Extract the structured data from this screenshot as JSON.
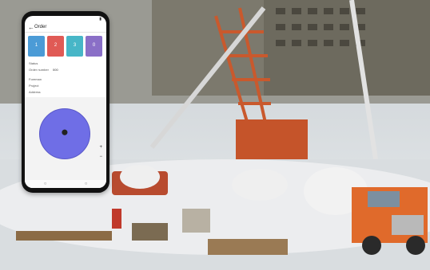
{
  "phone": {
    "status_time": "",
    "header": {
      "title": "Order"
    },
    "tiles": [
      {
        "num": "1",
        "label": ""
      },
      {
        "num": "2",
        "label": ""
      },
      {
        "num": "3",
        "label": ""
      },
      {
        "num": "0",
        "label": ""
      }
    ],
    "info": {
      "status_label": "Status",
      "status_value": "",
      "order_label": "Order number",
      "order_value": "000",
      "foreman_label": "Foreman",
      "foreman_value": "",
      "project_label": "Project",
      "project_value": "",
      "address_label": "Address",
      "address_value": ""
    },
    "map": {
      "zoom_in": "+",
      "zoom_out": "−"
    }
  },
  "colors": {
    "tile1": "#4b9bd6",
    "tile2": "#e05a55",
    "tile3": "#47b6c7",
    "tile4": "#8a6fc7",
    "geofence": "#6f6ee6",
    "status_pill": "#4f86c6"
  }
}
